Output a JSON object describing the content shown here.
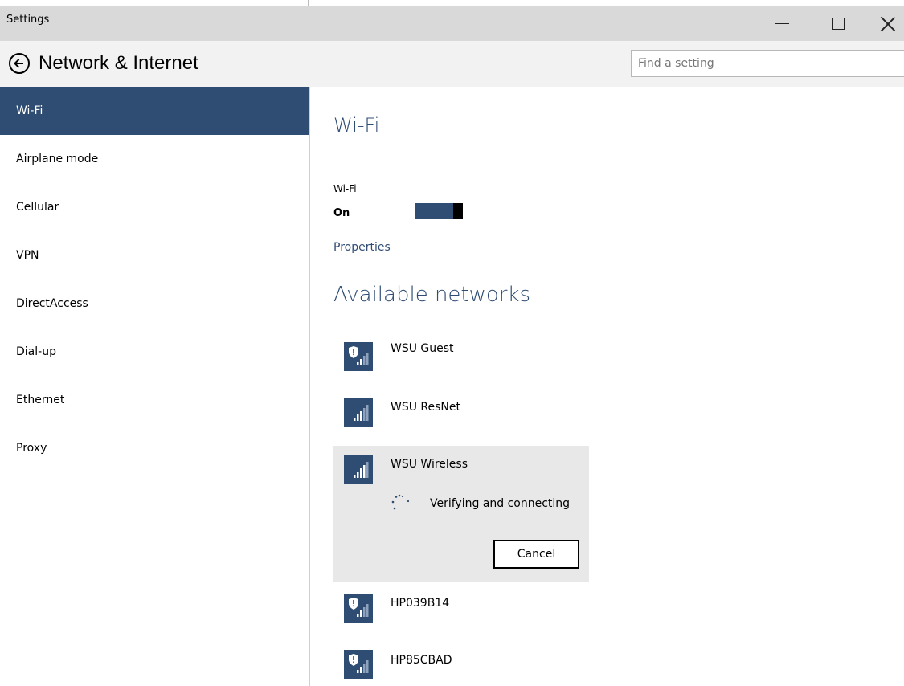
{
  "window": {
    "title": "Settings"
  },
  "header": {
    "title": "Network & Internet",
    "search_placeholder": "Find a setting"
  },
  "sidebar": {
    "items": [
      {
        "label": "Wi-Fi",
        "active": true
      },
      {
        "label": "Airplane mode"
      },
      {
        "label": "Cellular"
      },
      {
        "label": "VPN"
      },
      {
        "label": "DirectAccess"
      },
      {
        "label": "Dial-up"
      },
      {
        "label": "Ethernet"
      },
      {
        "label": "Proxy"
      }
    ]
  },
  "main": {
    "title": "Wi-Fi",
    "wifi_label": "Wi-Fi",
    "wifi_state": "On",
    "properties_link": "Properties",
    "available_title": "Available networks",
    "networks": [
      {
        "name": "WSU Guest",
        "secured": false,
        "shield": true
      },
      {
        "name": "WSU ResNet",
        "shield": false
      },
      {
        "name": "WSU Wireless",
        "shield": false,
        "status": "Verifying and connecting",
        "cancel_label": "Cancel"
      },
      {
        "name": "HP039B14",
        "shield": true
      },
      {
        "name": "HP85CBAD",
        "shield": true
      }
    ]
  },
  "colors": {
    "accent": "#2f4d73",
    "titlebar": "#d9d9d9",
    "header": "#f2f2f2",
    "selected": "#e8e8e8"
  }
}
